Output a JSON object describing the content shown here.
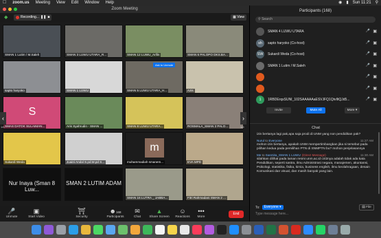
{
  "menubar": {
    "app": "zoom.us",
    "items": [
      "Meeting",
      "View",
      "Edit",
      "Window",
      "Help"
    ],
    "clock": "Sun 11:21"
  },
  "window": {
    "title": "Zoom Meeting"
  },
  "recording": {
    "label": "Recording..."
  },
  "view_button": {
    "label": "View"
  },
  "pages": {
    "left": "1/6",
    "right": "1/6"
  },
  "tiles": [
    {
      "name": "SMAN 1 Lutim / M.Saleh",
      "bg": "#4a4f55"
    },
    {
      "name": "SMAN 3 LUWU UTARA_R...",
      "bg": "#6b6a66"
    },
    {
      "name": "SMAN 12 LUWU_Arifin",
      "bg": "#7a8e62"
    },
    {
      "name": "SMAN 6 PALOPO DKS.BA...",
      "bg": "#8a8a7a"
    },
    {
      "name": "sapto haryoko",
      "bg": "#8d8f93"
    },
    {
      "name": "SMAN 1 LUWU",
      "bg": "#d8d8d8"
    },
    {
      "name": "SMAN 5 LUWU UTARA_H...",
      "bg": "#6e6a62"
    },
    {
      "name": "Azis",
      "bg": "#c9c2ad"
    },
    {
      "name": "SMAS DATOK SULAIMAN...",
      "bg": "#d04a77",
      "letter": "S"
    },
    {
      "name": "Aris Syahrudin - SMAN ...",
      "bg": "#6a8a5a"
    },
    {
      "name": "SMAN 8 LUWU UTARA...",
      "bg": "#d5c35a"
    },
    {
      "name": "ROSMALA_SMAN 2 PALO...",
      "bg": "#8a8078"
    },
    {
      "name": "Sukardi Weda",
      "bg": "#e3c64a"
    },
    {
      "name": "Juaini Andal S.pd.M.pd S...",
      "bg": "#d0d0d0"
    },
    {
      "name": "muhammadiah smanem...",
      "bg": "#1c1c1c",
      "letter": "m"
    },
    {
      "name": "EVA MPD",
      "bg": "#bba98a"
    },
    {
      "name": "Nur Inaya (Sman 8 Luw...",
      "big": true
    },
    {
      "name": "SMAN 2 LUTIM ADAM",
      "big": true
    },
    {
      "name": "SMAN 16 LUTRA _ JABBA...",
      "bg": "#9a9a8a"
    },
    {
      "name": "Fitri Rahmadani SMAN 2 ...",
      "bg": "#b0a68e"
    }
  ],
  "tile_overlay": {
    "button": "Ask to Unmute"
  },
  "toolbar": {
    "unmute": "Unmute",
    "start_video": "Start Video",
    "security": "Security",
    "participants": "Participants",
    "participants_count": "168",
    "chat": "Chat",
    "share_screen": "Share Screen",
    "reactions": "Reactions",
    "more": "More",
    "end": "End"
  },
  "panel": {
    "title": "Participants (168)",
    "search_placeholder": "Search",
    "participants": [
      {
        "initials": "",
        "name": "SMAN 4 LUWU UTARA",
        "color": "#555555"
      },
      {
        "initials": "sh",
        "name": "sapto haryoko (Co-host)",
        "color": "#596874"
      },
      {
        "initials": "SW",
        "name": "Sukardi Weda (Co-host)",
        "color": "#4b5d66"
      },
      {
        "initials": "",
        "name": "SMAN 1 Lutim / M.Saleh",
        "color": "#6b6b6b"
      },
      {
        "initials": "",
        "name": "",
        "color": "#e05a1e"
      },
      {
        "initials": "",
        "name": "",
        "color": "#e05a1e"
      },
      {
        "initials": "1",
        "name": "1RBDErqsSUNI_102SAAAAAaESVJFQ1QtvIltQJd5...",
        "color": "#2e9a5c"
      }
    ],
    "invite": "Invite",
    "mute_all": "Mute All",
    "more": "More"
  },
  "chat": {
    "title": "Chat",
    "messages": [
      {
        "from": "",
        "to": "",
        "time": "",
        "text": "izin bertanya lagi pak,apa saja prodi di UNM yang non pendidikan pak?",
        "dm": false
      },
      {
        "from": "Nurul",
        "to": "Everyone",
        "time": "11:27 AM",
        "text": "mohon izin bertanya, apakah UNM mempertimbangkan jika si tersebut pada pilihan kedua pada pemilihan PTN di SNMPTN bu? mohon penjelasannya",
        "dm": false
      },
      {
        "from": "Me",
        "to": "Sasmita_SMAN 1 LUWU",
        "tag": "(Direct Message)",
        "time": "11:30 AM",
        "text": "silahkan dilihat pada laman resmi unm.ac.id ciri2nya adalah tidak ada kata Pendidikan, seperti sastra, ilmu Administrasi negara, manajemen, akuntansi, Psikologi, statistika, fisika, kimia, business english, ilmu keolahragaan, desain Komunikasi dan visual, dan masih banyak yang lain.",
        "dm": true
      }
    ],
    "to_label": "To:",
    "to_target": "Everyone",
    "file_button": "File",
    "input_placeholder": "Type message here..."
  },
  "colors": {
    "accent": "#0e72ed",
    "end": "#e02828",
    "dm": "#e05555",
    "recording": "#e0352b"
  }
}
